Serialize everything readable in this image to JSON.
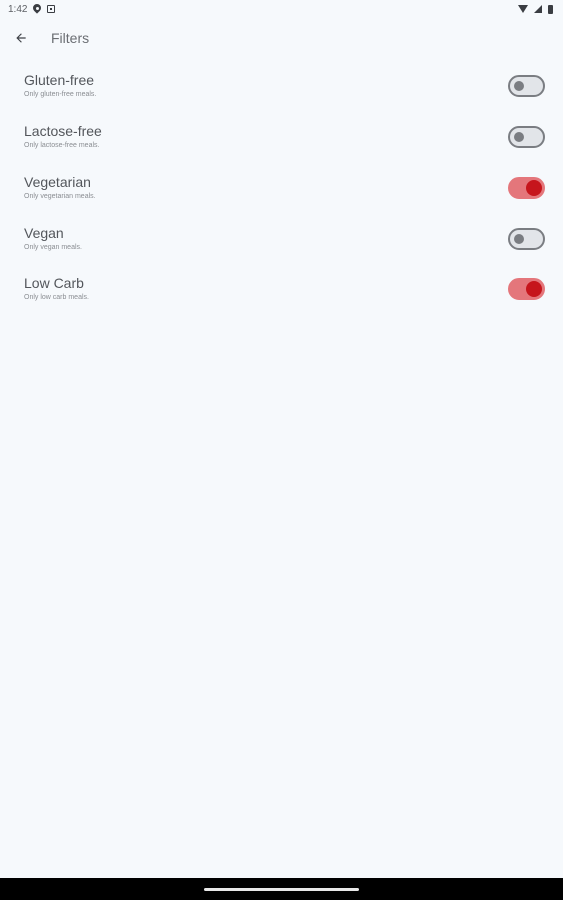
{
  "status_bar": {
    "time": "1:42",
    "icons": [
      "location-icon",
      "media-icon",
      "wifi-icon",
      "signal-icon",
      "battery-icon"
    ]
  },
  "app_bar": {
    "back_icon": "arrow-back-icon",
    "title": "Filters"
  },
  "colors": {
    "background": "#f6f9fc",
    "switch_on_track": "#e4767b",
    "switch_on_thumb": "#c6151c",
    "switch_off_track": "#e2e5e9",
    "switch_off_outline": "#7a7d82"
  },
  "filters": [
    {
      "title": "Gluten-free",
      "subtitle": "Only gluten-free meals.",
      "enabled": false
    },
    {
      "title": "Lactose-free",
      "subtitle": "Only lactose-free meals.",
      "enabled": false
    },
    {
      "title": "Vegetarian",
      "subtitle": "Only vegetarian meals.",
      "enabled": true
    },
    {
      "title": "Vegan",
      "subtitle": "Only vegan meals.",
      "enabled": false
    },
    {
      "title": "Low Carb",
      "subtitle": "Only low carb meals.",
      "enabled": true
    }
  ]
}
